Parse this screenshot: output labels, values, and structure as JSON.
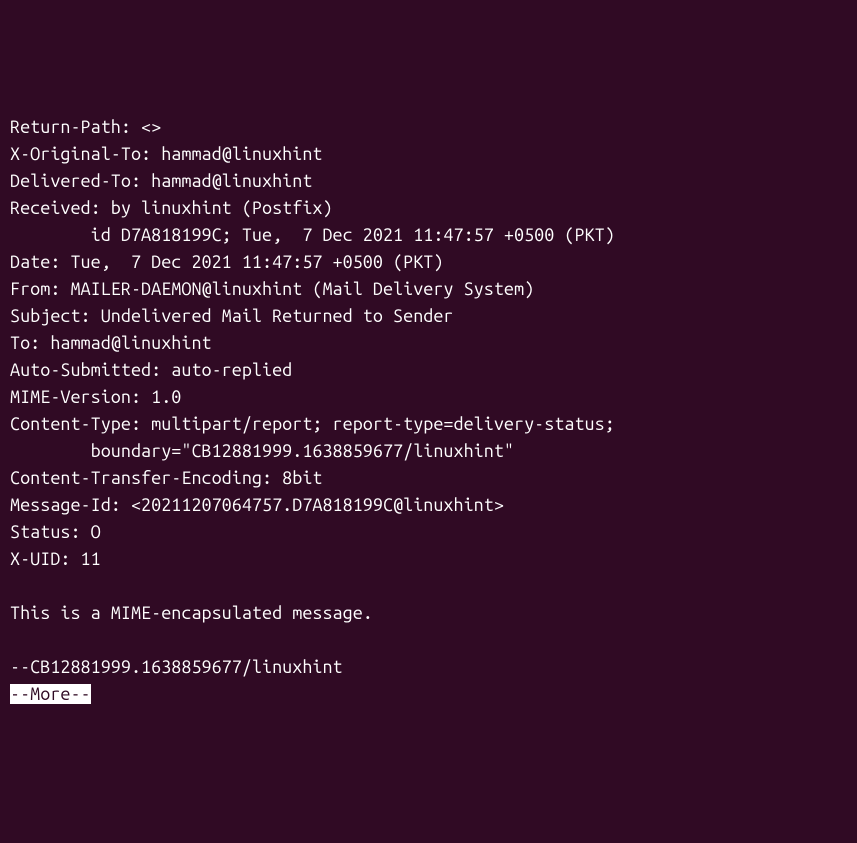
{
  "headers": {
    "return_path": "Return-Path: <>",
    "x_original_to": "X-Original-To: hammad@linuxhint",
    "delivered_to": "Delivered-To: hammad@linuxhint",
    "received_line1": "Received: by linuxhint (Postfix)",
    "received_line2": "        id D7A818199C; Tue,  7 Dec 2021 11:47:57 +0500 (PKT)",
    "date": "Date: Tue,  7 Dec 2021 11:47:57 +0500 (PKT)",
    "from": "From: MAILER-DAEMON@linuxhint (Mail Delivery System)",
    "subject": "Subject: Undelivered Mail Returned to Sender",
    "to": "To: hammad@linuxhint",
    "auto_submitted": "Auto-Submitted: auto-replied",
    "mime_version": "MIME-Version: 1.0",
    "content_type_line1": "Content-Type: multipart/report; report-type=delivery-status;",
    "content_type_line2": "        boundary=\"CB12881999.1638859677/linuxhint\"",
    "content_transfer_encoding": "Content-Transfer-Encoding: 8bit",
    "message_id": "Message-Id: <20211207064757.D7A818199C@linuxhint>",
    "status": "Status: O",
    "x_uid": "X-UID: 11"
  },
  "body": {
    "blank1": "",
    "mime_note": "This is a MIME-encapsulated message.",
    "blank2": "",
    "boundary": "--CB12881999.1638859677/linuxhint"
  },
  "pager": {
    "more_prompt": "--More--"
  }
}
